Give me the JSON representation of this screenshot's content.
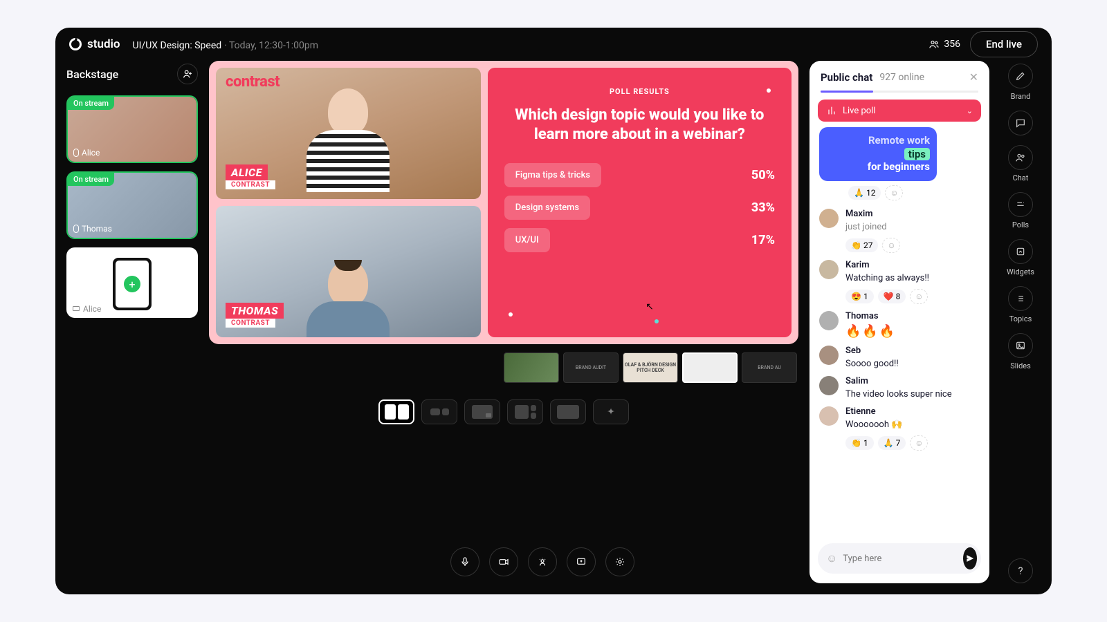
{
  "header": {
    "brand": "studio",
    "session_title": "UI/UX Design: Speed",
    "session_time": "Today, 12:30-1:00pm",
    "viewer_count": "356",
    "end_label": "End live"
  },
  "backstage": {
    "title": "Backstage",
    "tiles": [
      {
        "name": "Alice",
        "badge": "On stream"
      },
      {
        "name": "Thomas",
        "badge": "On stream"
      },
      {
        "name": "Alice",
        "badge": ""
      }
    ]
  },
  "stage": {
    "watermark": "contrast",
    "speakers": [
      {
        "name": "ALICE",
        "company": "CONTRAST"
      },
      {
        "name": "THOMAS",
        "company": "CONTRAST"
      }
    ],
    "poll": {
      "kicker": "POLL RESULTS",
      "question": "Which design topic would you like to learn more about in a webinar?",
      "options": [
        {
          "label": "Figma tips & tricks",
          "pct": "50%"
        },
        {
          "label": "Design systems",
          "pct": "33%"
        },
        {
          "label": "UX/UI",
          "pct": "17%"
        }
      ]
    },
    "slides": [
      "",
      "BRAND AUDIT",
      "OLAF & BJÖRN DESIGN PITCH DECK",
      "",
      "BRAND AU"
    ]
  },
  "chart_data": {
    "type": "bar",
    "title": "Which design topic would you like to learn more about in a webinar?",
    "subtitle": "POLL RESULTS",
    "categories": [
      "Figma tips & tricks",
      "Design systems",
      "UX/UI"
    ],
    "values": [
      50,
      33,
      17
    ],
    "ylabel": "%",
    "ylim": [
      0,
      100
    ]
  },
  "chat": {
    "title": "Public chat",
    "online": "927 online",
    "live_poll_label": "Live poll",
    "promo": {
      "line1": "Remote work",
      "tips": "tips",
      "line2": "for beginners"
    },
    "promo_react": {
      "emoji": "🙏",
      "count": "12"
    },
    "messages": [
      {
        "name": "Maxim",
        "text": "just joined",
        "sub": true,
        "reactions": [
          {
            "e": "👏",
            "c": "27"
          }
        ],
        "avatar": "#d0b090"
      },
      {
        "name": "Karim",
        "text": "Watching as always!!",
        "reactions": [
          {
            "e": "😍",
            "c": "1"
          },
          {
            "e": "❤️",
            "c": "8"
          }
        ],
        "avatar": "#c8b8a0"
      },
      {
        "name": "Thomas",
        "text": "🔥🔥🔥",
        "fires": true,
        "avatar": "#b0b0b0"
      },
      {
        "name": "Seb",
        "text": "Soooo good!!",
        "avatar": "#a89080"
      },
      {
        "name": "Salim",
        "text": "The video looks super nice",
        "avatar": "#888078"
      },
      {
        "name": "Etienne",
        "text": "Wooooooh 🙌",
        "reactions": [
          {
            "e": "👏",
            "c": "1"
          },
          {
            "e": "🙏",
            "c": "7"
          }
        ],
        "avatar": "#d8c0b0"
      }
    ],
    "input_placeholder": "Type here"
  },
  "rail": {
    "items": [
      "Brand",
      "",
      "Chat",
      "Polls",
      "Widgets",
      "Topics",
      "Slides"
    ]
  }
}
